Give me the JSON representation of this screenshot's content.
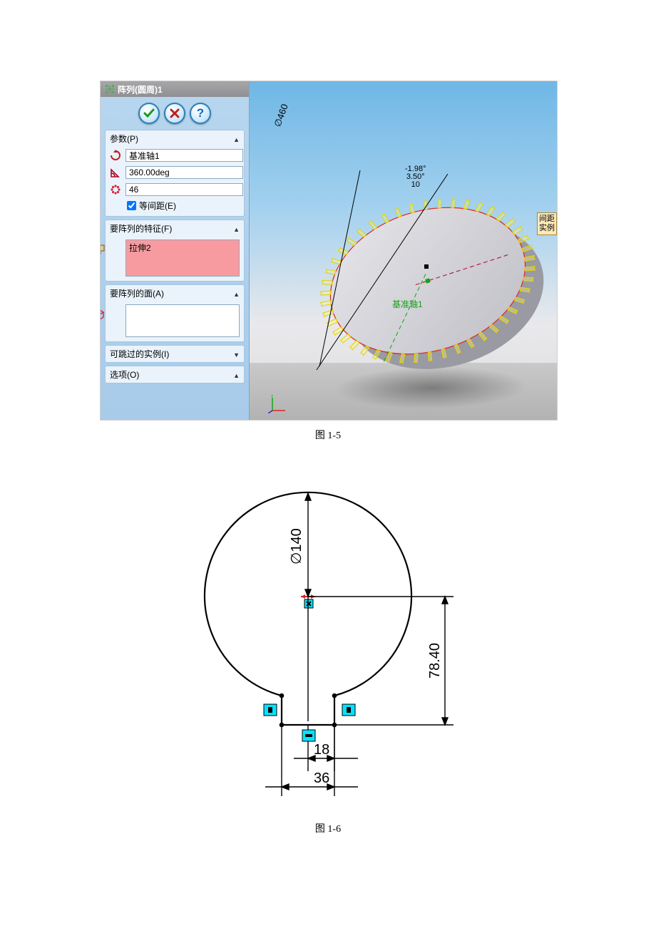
{
  "panel": {
    "title": "阵列(圆周)1",
    "sections": {
      "params": {
        "header": "参数(P)",
        "axis_value": "基准轴1",
        "angle_value": "360.00deg",
        "count_value": "46",
        "equal_spacing_label": "等间距(E)",
        "equal_spacing_checked": true
      },
      "features": {
        "header": "要阵列的特征(F)",
        "item": "拉伸2"
      },
      "faces": {
        "header": "要阵列的面(A)"
      },
      "skip": {
        "header": "可跳过的实例(I)"
      },
      "options": {
        "header": "选项(O)"
      }
    }
  },
  "viewport": {
    "diameter_label": "∅460",
    "top_dims": {
      "a": "-1.98°",
      "b": "3.50°",
      "c": "10"
    },
    "axis_label": "基准轴1",
    "callout_line1": "间距",
    "callout_line2": "实例"
  },
  "captions": {
    "fig1": "图 1-5",
    "fig2": "图 1-6"
  },
  "sketch": {
    "diameter": "∅140",
    "h_right": "78.40",
    "bottom_half": "18",
    "bottom_full": "36"
  }
}
